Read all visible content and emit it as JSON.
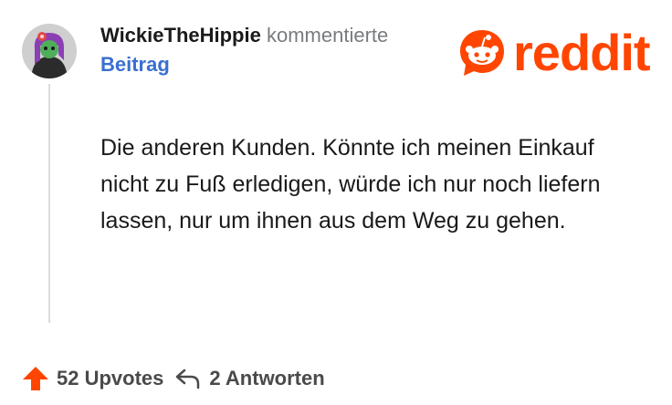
{
  "comment": {
    "username": "WickieTheHippie",
    "action": "kommentierte",
    "post_link": "Beitrag",
    "body": "Die anderen Kunden. Könnte ich meinen Einkauf nicht zu Fuß erledigen, würde ich nur noch liefern lassen, nur um ihnen aus dem Weg zu gehen."
  },
  "footer": {
    "upvotes": "52 Upvotes",
    "replies": "2 Antworten"
  },
  "logo": {
    "wordmark": "reddit",
    "icon": "reddit-alien-icon"
  },
  "avatar": {
    "icon": "avatar-image"
  },
  "colors": {
    "brand": "#ff4500",
    "link": "#3a6fd1",
    "text": "#1a1a1b",
    "muted": "#787c7e"
  }
}
